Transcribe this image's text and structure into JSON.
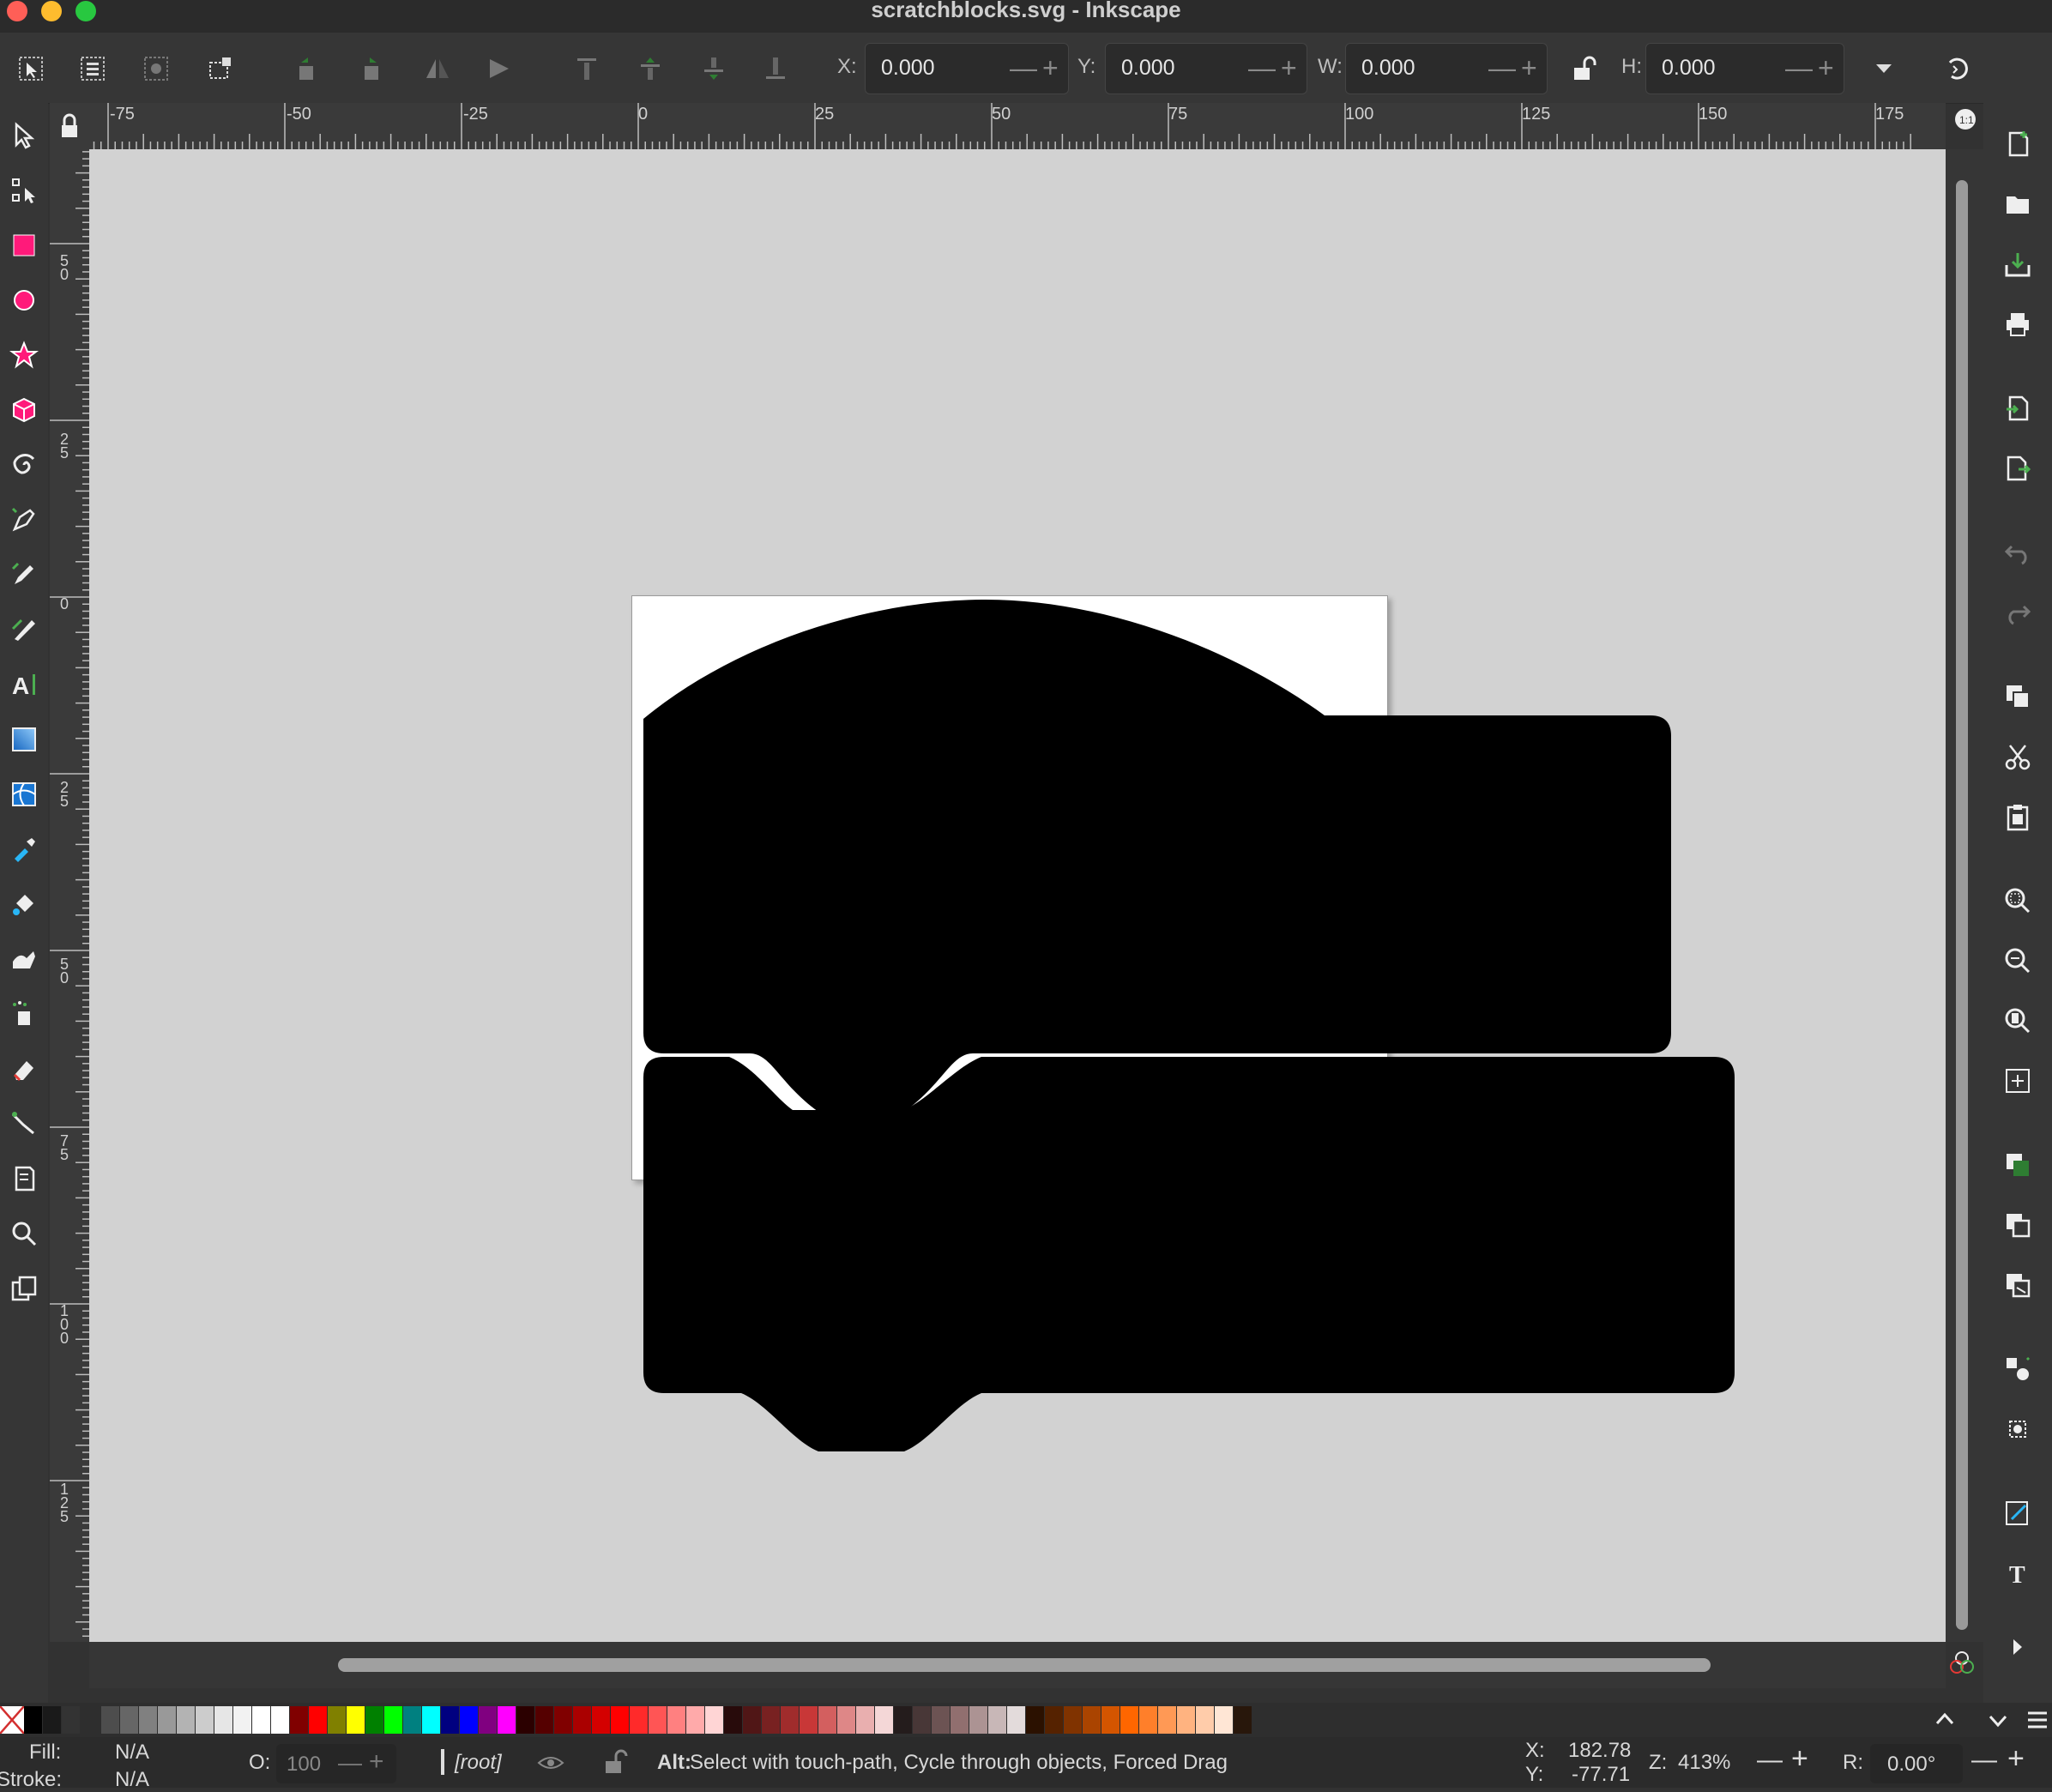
{
  "window": {
    "title": "scratchblocks.svg - Inkscape"
  },
  "toolbar": {
    "x_label": "X:",
    "x_value": "0.000",
    "y_label": "Y:",
    "y_value": "0.000",
    "w_label": "W:",
    "w_value": "0.000",
    "h_label": "H:",
    "h_value": "0.000"
  },
  "ruler": {
    "horizontal": [
      "-75",
      "-50",
      "-25",
      "0",
      "25",
      "50",
      "75",
      "100",
      "125",
      "150",
      "175"
    ],
    "vertical": [
      "5\n0",
      "2\n5",
      "0",
      "2\n5",
      "5\n0",
      "7\n5",
      "1\n0\n0",
      "1\n2\n5"
    ]
  },
  "tools": [
    "selector-tool",
    "node-tool",
    "rectangle-tool",
    "ellipse-tool",
    "star-tool",
    "box3d-tool",
    "spiral-tool",
    "pen-tool",
    "pencil-tool",
    "calligraphy-tool",
    "text-tool",
    "gradient-tool",
    "mesh-tool",
    "dropper-tool",
    "paint-bucket-tool",
    "tweak-tool",
    "spray-tool",
    "eraser-tool",
    "connector-tool",
    "pages-tool",
    "zoom-tool",
    "clone-tool"
  ],
  "palette": [
    "#000000",
    "#1a1a1a",
    "#333333",
    "#4d4d4d",
    "#666666",
    "#808080",
    "#999999",
    "#b3b3b3",
    "#cccccc",
    "#e6e6e6",
    "#f2f2f2",
    "#ffffff",
    "#ffffff",
    "#800000",
    "#ff0000",
    "#808000",
    "#ffff00",
    "#008000",
    "#00ff00",
    "#008080",
    "#00ffff",
    "#000080",
    "#0000ff",
    "#800080",
    "#ff00ff",
    "#2b0000",
    "#550000",
    "#800000",
    "#aa0000",
    "#d40000",
    "#ff0000",
    "#ff2a2a",
    "#ff5555",
    "#ff8080",
    "#ffaaaa",
    "#ffd5d5",
    "#280b0b",
    "#501616",
    "#782121",
    "#a02c2c",
    "#c83737",
    "#d35f5f",
    "#de8787",
    "#e9afaf",
    "#f4d7d7",
    "#241c1c",
    "#483737",
    "#6c5353",
    "#916f6f",
    "#ac9393",
    "#c8b7b7",
    "#e3dbdb",
    "#2b1100",
    "#552200",
    "#803300",
    "#aa4400",
    "#d45500",
    "#ff6600",
    "#ff7f2a",
    "#ff9955",
    "#ffb380",
    "#ffccaa",
    "#ffe6d5",
    "#28170b"
  ],
  "status": {
    "fill_label": "Fill:",
    "fill_value": "N/A",
    "stroke_label": "Stroke:",
    "stroke_value": "N/A",
    "opacity_label": "O:",
    "opacity_value": "100",
    "layer": "[root]",
    "message_key": "Alt:",
    "message": " Select with touch-path, Cycle through objects, Forced Drag",
    "cursor_x_label": "X:",
    "cursor_x": "182.78",
    "cursor_y_label": "Y:",
    "cursor_y": "-77.71",
    "zoom_label": "Z:",
    "zoom": "413%",
    "rotation_label": "R:",
    "rotation": "0.00°"
  }
}
